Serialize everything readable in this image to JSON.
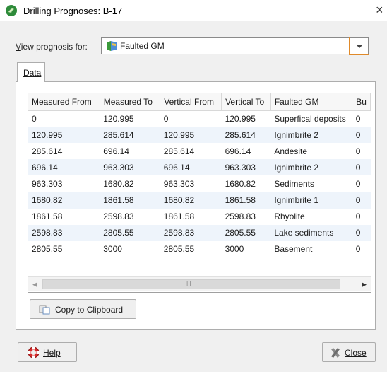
{
  "window": {
    "title": "Drilling Prognoses: B-17",
    "close_glyph": "×"
  },
  "view": {
    "label_prefix": "V",
    "label_rest": "iew prognosis for:",
    "selected": "Faulted GM"
  },
  "tabs": [
    {
      "label": "Data"
    }
  ],
  "table": {
    "columns": [
      "Measured From",
      "Measured To",
      "Vertical From",
      "Vertical To",
      "Faulted GM",
      "Bu"
    ],
    "rows": [
      [
        "0",
        "120.995",
        "0",
        "120.995",
        "Superfical deposits",
        "0"
      ],
      [
        "120.995",
        "285.614",
        "120.995",
        "285.614",
        "Ignimbrite 2",
        "0"
      ],
      [
        "285.614",
        "696.14",
        "285.614",
        "696.14",
        "Andesite",
        "0"
      ],
      [
        "696.14",
        "963.303",
        "696.14",
        "963.303",
        "Ignimbrite 2",
        "0"
      ],
      [
        "963.303",
        "1680.82",
        "963.303",
        "1680.82",
        "Sediments",
        "0"
      ],
      [
        "1680.82",
        "1861.58",
        "1680.82",
        "1861.58",
        "Ignimbrite 1",
        "0"
      ],
      [
        "1861.58",
        "2598.83",
        "1861.58",
        "2598.83",
        "Rhyolite",
        "0"
      ],
      [
        "2598.83",
        "2805.55",
        "2598.83",
        "2805.55",
        "Lake sediments",
        "0"
      ],
      [
        "2805.55",
        "3000",
        "2805.55",
        "3000",
        "Basement",
        "0"
      ]
    ]
  },
  "scrollbar": {
    "left_arrow": "◀",
    "right_arrow": "▶",
    "grip": "III"
  },
  "buttons": {
    "copy": "Copy to Clipboard",
    "help": "Help",
    "close": "Close"
  },
  "colors": {
    "accent_outline": "#e08a2a",
    "row_alt": "#eef4fb"
  }
}
